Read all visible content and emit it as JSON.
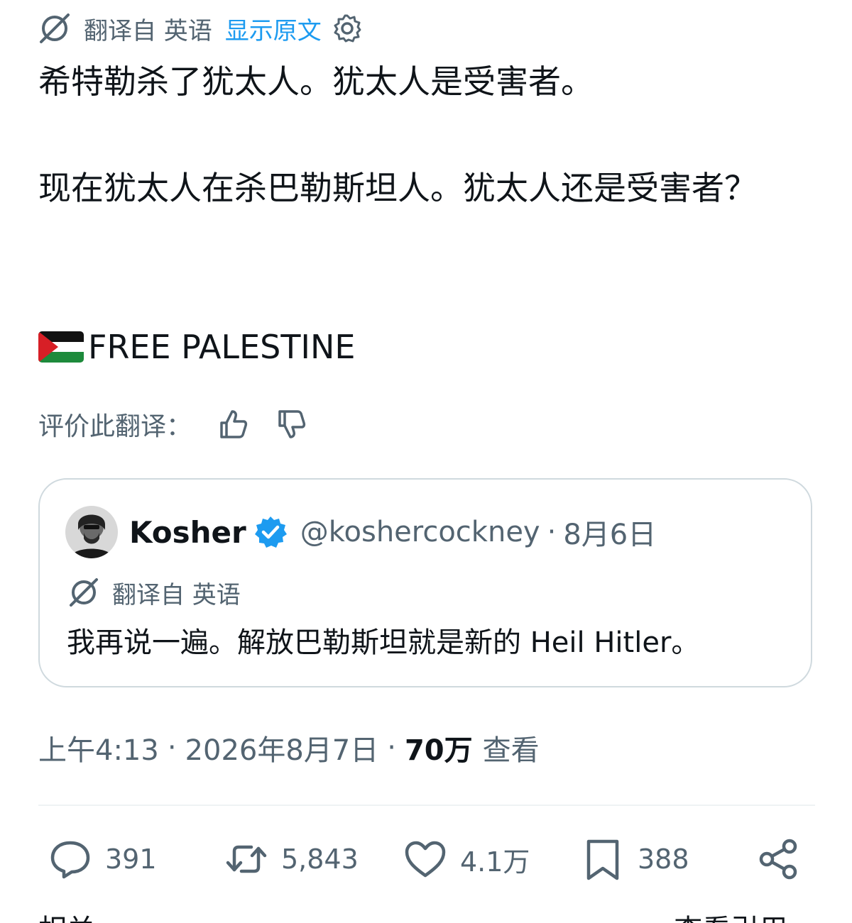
{
  "translation_header": {
    "translated_from": "翻译自 英语",
    "show_original": "显示原文",
    "translate_icon": "translate-icon",
    "settings_icon": "gear-icon"
  },
  "tweet": {
    "line1": "希特勒杀了犹太人。犹太人是受害者。",
    "line2": "现在犹太人在杀巴勒斯坦人。犹太人还是受害者？",
    "flag": "palestine-flag-icon",
    "line3": "FREE PALESTINE"
  },
  "rating": {
    "label": "评价此翻译：",
    "like_icon": "thumbs-up-icon",
    "dislike_icon": "thumbs-down-icon"
  },
  "quote": {
    "name": "Kosher",
    "handle": "@koshercockney",
    "separator": "·",
    "date": "8月6日",
    "translated_from": "翻译自 英语",
    "text": "我再说一遍。解放巴勒斯坦就是新的 Heil Hitler。"
  },
  "meta": {
    "time": "上午4:13",
    "sep1": "·",
    "date": "2026年8月7日",
    "sep2": "·",
    "views_count": "70万",
    "views_label": "查看"
  },
  "actions": {
    "replies": "391",
    "reposts": "5,843",
    "likes": "4.1万",
    "bookmarks": "388"
  },
  "bottom": {
    "left": "相关",
    "right": "查看引用 ›"
  },
  "colors": {
    "accent": "#1d9bf0",
    "text": "#0f1419",
    "secondary": "#536471",
    "border": "#cfd9de"
  }
}
